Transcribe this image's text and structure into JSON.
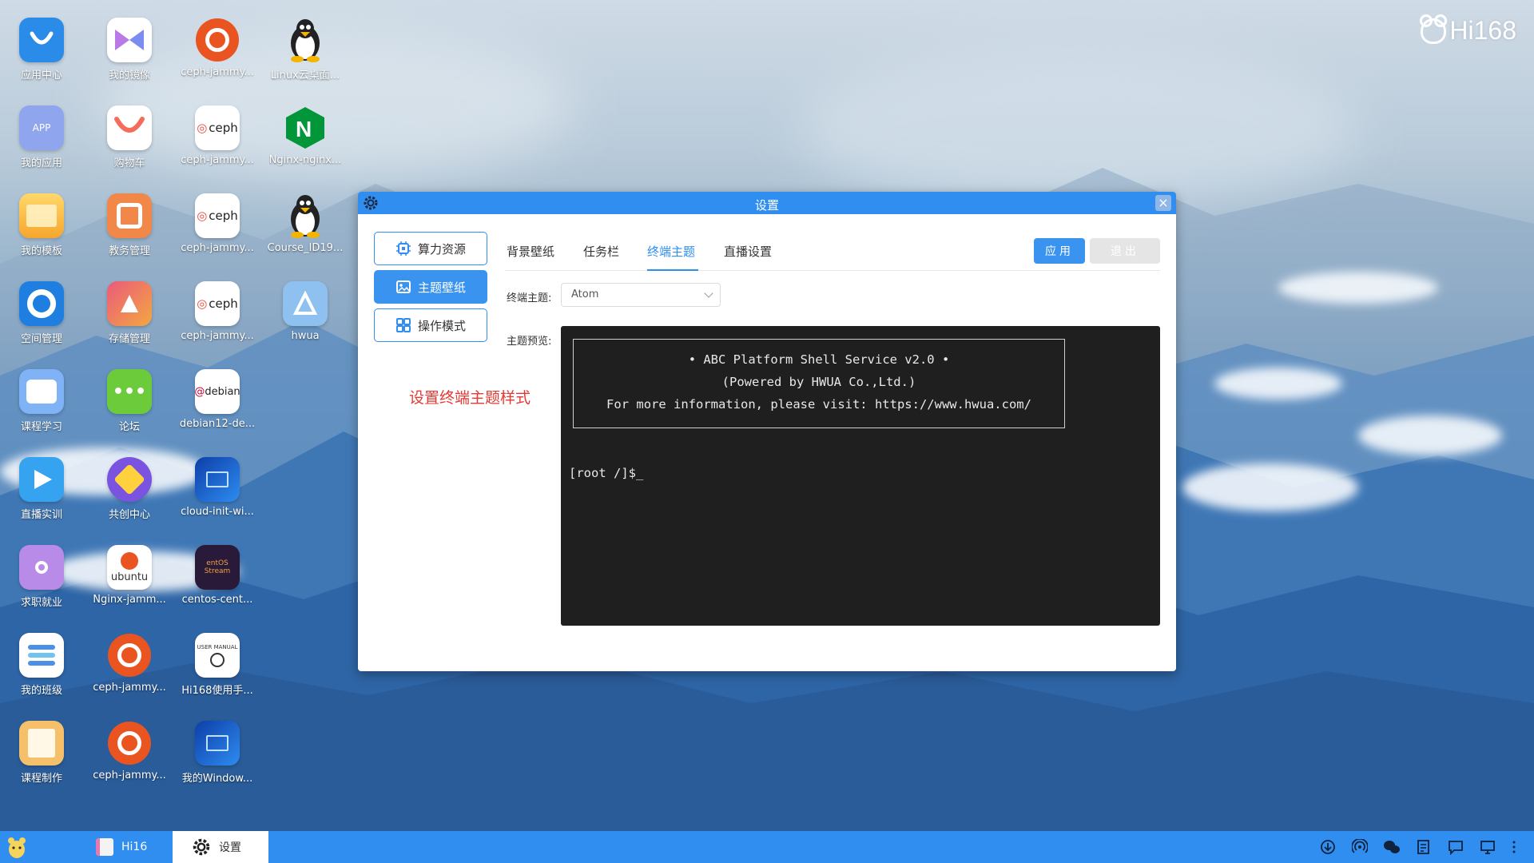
{
  "brand": {
    "logo_text": "Hi168"
  },
  "desktop": {
    "icons": [
      {
        "label": "应用中心",
        "icon": "app-center-icon",
        "color": "#2b8be8"
      },
      {
        "label": "我的应用",
        "icon": "my-apps-icon",
        "color": "#8fa6ee",
        "badge": "APP"
      },
      {
        "label": "我的模板",
        "icon": "folder-icon",
        "color": "#f6b13c"
      },
      {
        "label": "空间管理",
        "icon": "space-ring-icon",
        "color": "#1f7fe0"
      },
      {
        "label": "课程学习",
        "icon": "course-icon",
        "color": "#7fb3f6"
      },
      {
        "label": "直播实训",
        "icon": "play-icon",
        "color": "#36a3f0"
      },
      {
        "label": "求职就业",
        "icon": "job-icon",
        "color": "#b98be8"
      },
      {
        "label": "我的班级",
        "icon": "class-icon",
        "color": "#ffffff"
      },
      {
        "label": "课程制作",
        "icon": "course-make-icon",
        "color": "#f6c06b"
      },
      {
        "label": "我的镜像",
        "icon": "mirror-icon",
        "color": "#ffffff"
      },
      {
        "label": "购物车",
        "icon": "cart-icon",
        "color": "#ffffff"
      },
      {
        "label": "教务管理",
        "icon": "edu-icon",
        "color": "#f2874a"
      },
      {
        "label": "存储管理",
        "icon": "storage-icon",
        "color": "#ea5a7a"
      },
      {
        "label": "论坛",
        "icon": "forum-icon",
        "color": "#6ccb3a"
      },
      {
        "label": "共创中心",
        "icon": "cocreate-icon",
        "color": "#7a54e0"
      },
      {
        "label": "Nginx-jamm...",
        "icon": "ubuntu-wordmark-icon",
        "color": "#ffffff",
        "badge": "ubuntu"
      },
      {
        "label": "ceph-jammy...",
        "icon": "ubuntu-icon",
        "color": "#e95420"
      },
      {
        "label": "ceph-jammy...",
        "icon": "ubuntu-icon",
        "color": "#e95420"
      },
      {
        "label": "ceph-jammy...",
        "icon": "ceph-icon",
        "color": "#ffffff",
        "badge": "ceph"
      },
      {
        "label": "ceph-jammy...",
        "icon": "ceph-icon",
        "color": "#ffffff",
        "badge": "ceph"
      },
      {
        "label": "ceph-jammy...",
        "icon": "ceph-icon",
        "color": "#ffffff",
        "badge": "ceph"
      },
      {
        "label": "debian12-de...",
        "icon": "debian-icon",
        "color": "#ffffff",
        "badge": "debian"
      },
      {
        "label": "cloud-init-wi...",
        "icon": "windows-icon",
        "color": "#1e6fd6"
      },
      {
        "label": "centos-cent...",
        "icon": "centos-stream-icon",
        "color": "#2a1a3a",
        "badge": "entOS Stream"
      },
      {
        "label": "Hi168使用手...",
        "icon": "user-manual-icon",
        "color": "#ffffff",
        "badge": "USER MANUAL"
      },
      {
        "label": "我的Window...",
        "icon": "windows-icon",
        "color": "#1e6fd6"
      },
      {
        "label": "ceph-jammy...",
        "icon": "ubuntu-icon",
        "color": "#e95420"
      },
      {
        "label": "Linux云桌面...",
        "icon": "linux-penguin-icon",
        "color": "#ffffff"
      },
      {
        "label": "Nginx-nginx...",
        "icon": "nginx-icon",
        "color": "#ffffff"
      },
      {
        "label": "Course_ID19...",
        "icon": "linux-penguin-icon",
        "color": "#ffffff"
      },
      {
        "label": "hwua",
        "icon": "hwua-icon",
        "color": "#8ec0f0"
      }
    ]
  },
  "window": {
    "title": "设置",
    "sidebar": [
      {
        "label": "算力资源",
        "icon": "cpu-icon",
        "active": false
      },
      {
        "label": "主题壁纸",
        "icon": "image-icon",
        "active": true
      },
      {
        "label": "操作模式",
        "icon": "grid-icon",
        "active": false
      }
    ],
    "tabs": [
      {
        "label": "背景壁纸",
        "active": false
      },
      {
        "label": "任务栏",
        "active": false
      },
      {
        "label": "终端主题",
        "active": true
      },
      {
        "label": "直播设置",
        "active": false
      }
    ],
    "apply_label": "应用",
    "exit_label": "退出",
    "theme_label": "终端主题:",
    "theme_value": "Atom",
    "preview_label": "主题预览:",
    "terminal": {
      "line1": "• ABC Platform Shell Service v2.0 •",
      "line2": "(Powered by HWUA Co.,Ltd.)",
      "line3": "For more information, please visit: https://www.hwua.com/",
      "prompt": "[root /]$_"
    },
    "annotation": "设置终端主题样式"
  },
  "taskbar": {
    "items": [
      {
        "label": "Hi16",
        "icon": "hi16-app-icon"
      },
      {
        "label": "设置",
        "icon": "gear-icon",
        "active": true
      }
    ],
    "tray": [
      "download-icon",
      "hotspot-icon",
      "wechat-icon",
      "notes-icon",
      "chat-icon",
      "display-icon",
      "more-icon"
    ]
  },
  "colors": {
    "accent": "#2f8ef0",
    "annotation": "#e53935",
    "terminal_bg": "#1f1f1f"
  }
}
